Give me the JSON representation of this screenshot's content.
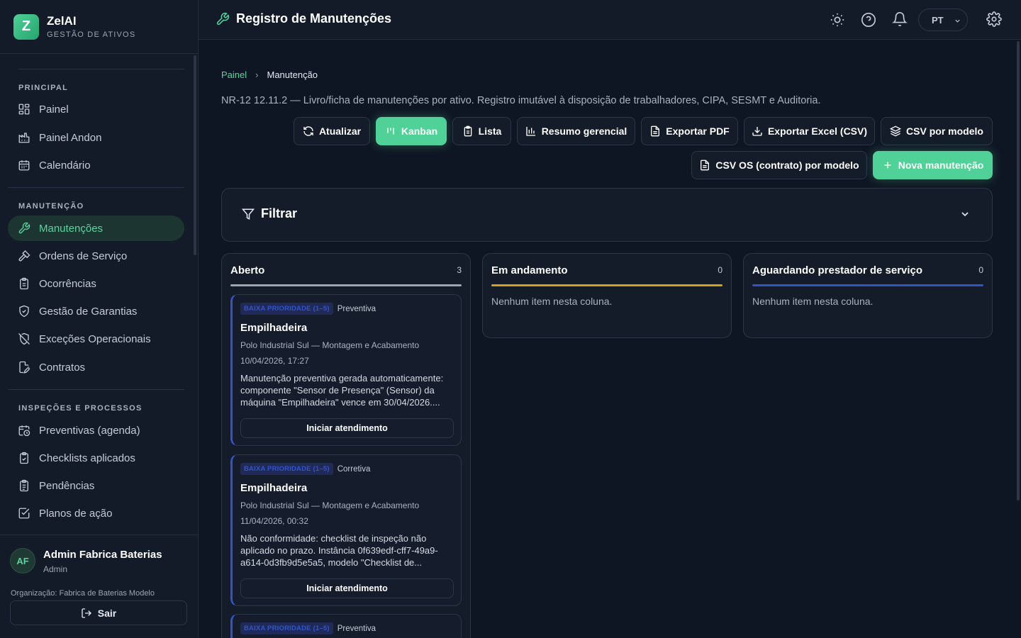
{
  "brand": {
    "logo_letter": "Z",
    "name": "ZelAI",
    "subtitle": "GESTÃO DE ATIVOS"
  },
  "sidebar": {
    "sections": [
      {
        "title": "PRINCIPAL",
        "items": [
          {
            "label": "Painel",
            "icon": "dashboard-icon"
          },
          {
            "label": "Painel Andon",
            "icon": "factory-icon"
          },
          {
            "label": "Calendário",
            "icon": "calendar-icon"
          }
        ]
      },
      {
        "title": "MANUTENÇÃO",
        "items": [
          {
            "label": "Manutenções",
            "icon": "wrench-icon",
            "active": true
          },
          {
            "label": "Ordens de Serviço",
            "icon": "hammer-icon"
          },
          {
            "label": "Ocorrências",
            "icon": "clipboard-icon"
          },
          {
            "label": "Gestão de Garantias",
            "icon": "shield-check-icon"
          },
          {
            "label": "Exceções Operacionais",
            "icon": "shield-off-icon"
          },
          {
            "label": "Contratos",
            "icon": "file-edit-icon"
          }
        ]
      },
      {
        "title": "INSPEÇÕES E PROCESSOS",
        "items": [
          {
            "label": "Preventivas (agenda)",
            "icon": "calendar-clock-icon"
          },
          {
            "label": "Checklists aplicados",
            "icon": "clipboard-check-icon"
          },
          {
            "label": "Pendências",
            "icon": "clipboard-list-icon"
          },
          {
            "label": "Planos de ação",
            "icon": "square-check-icon"
          }
        ]
      }
    ]
  },
  "user": {
    "initials": "AF",
    "name": "Admin Fabrica Baterias",
    "role": "Admin",
    "org": "Organização: Fabrica de Baterias Modelo",
    "logout_label": "Sair"
  },
  "header": {
    "title": "Registro de Manutenções",
    "language": "PT"
  },
  "breadcrumb": {
    "root": "Painel",
    "current": "Manutenção"
  },
  "description": "NR-12 12.11.2 — Livro/ficha de manutenções por ativo. Registro imutável à disposição de trabalhadores, CIPA, SESMT e Auditoria.",
  "toolbar": {
    "refresh": "Atualizar",
    "kanban": "Kanban",
    "list": "Lista",
    "summary": "Resumo gerencial",
    "export_pdf": "Exportar PDF",
    "export_excel": "Exportar Excel (CSV)",
    "csv_template": "CSV por modelo",
    "csv_os": "CSV OS (contrato) por modelo",
    "new": "Nova manutenção"
  },
  "filter": {
    "label": "Filtrar"
  },
  "kanban": {
    "columns": [
      {
        "title": "Aberto",
        "count": "3",
        "color": "#9aa5b5"
      },
      {
        "title": "Em andamento",
        "count": "0",
        "color": "#d4a017",
        "empty": "Nenhum item nesta coluna."
      },
      {
        "title": "Aguardando prestador de serviço",
        "count": "0",
        "color": "#3354c9",
        "empty": "Nenhum item nesta coluna."
      }
    ],
    "cards": [
      {
        "priority": "BAIXA PRIORIDADE (1–5)",
        "type": "Preventiva",
        "title": "Empilhadeira",
        "location": "Polo Industrial Sul — Montagem e Acabamento",
        "date": "10/04/2026, 17:27",
        "description": "Manutenção preventiva gerada automaticamente: componente \"Sensor de Presença\" (Sensor) da máquina \"Empilhadeira\" vence em 30/04/2026....",
        "action": "Iniciar atendimento"
      },
      {
        "priority": "BAIXA PRIORIDADE (1–5)",
        "type": "Corretiva",
        "title": "Empilhadeira",
        "location": "Polo Industrial Sul — Montagem e Acabamento",
        "date": "11/04/2026, 00:32",
        "description": "Não conformidade: checklist de inspeção não aplicado no prazo. Instância 0f639edf-cff7-49a9-a614-0d3fb9d5e5a5, modelo \"Checklist de...",
        "action": "Iniciar atendimento"
      },
      {
        "priority": "BAIXA PRIORIDADE (1–5)",
        "type": "Preventiva"
      }
    ]
  },
  "colors": {
    "accent": "#4fd197",
    "background": "#0f1623",
    "panel": "#141c2a",
    "priority_low": "#3354c9"
  }
}
